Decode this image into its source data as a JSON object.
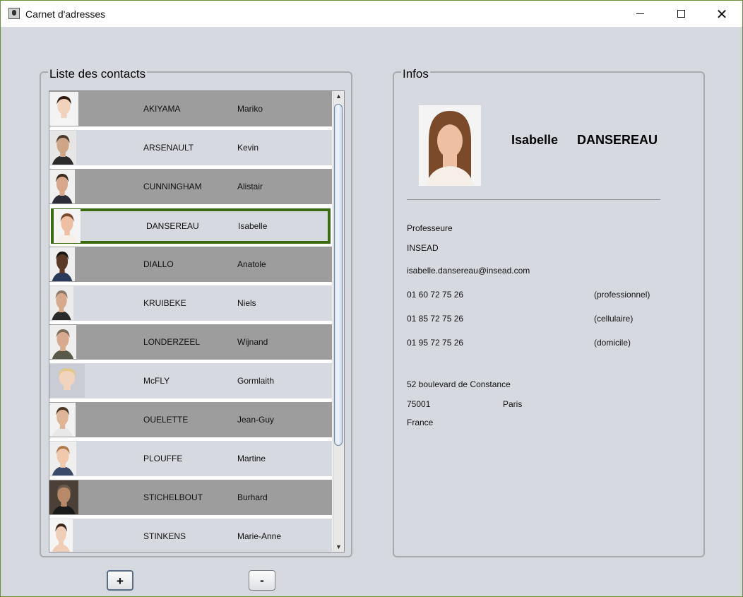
{
  "window": {
    "title": "Carnet d'adresses"
  },
  "list_panel": {
    "title": "Liste des contacts"
  },
  "contacts": [
    {
      "last_name": "AKIYAMA",
      "first_name": "Mariko",
      "highlighted": true,
      "selected": false,
      "hair": "#2a1a10",
      "skin": "#f1d2bd",
      "bg": "#f3f3f3",
      "shirt": "#f5f5f5",
      "w": 41
    },
    {
      "last_name": "ARSENAULT",
      "first_name": "Kevin",
      "highlighted": false,
      "selected": false,
      "hair": "#4a3a2e",
      "skin": "#cfa587",
      "bg": "#e6e6e6",
      "shirt": "#2a2a2a",
      "w": 38
    },
    {
      "last_name": "CUNNINGHAM",
      "first_name": "Alistair",
      "highlighted": true,
      "selected": false,
      "hair": "#3a2a1e",
      "skin": "#d9a88a",
      "bg": "#f0f0f0",
      "shirt": "#2c2c36",
      "w": 36
    },
    {
      "last_name": "DANSEREAU",
      "first_name": "Isabelle",
      "highlighted": false,
      "selected": true,
      "hair": "#7a4a2a",
      "skin": "#eebfa3",
      "bg": "#f4f4f4",
      "shirt": "#f5efe8",
      "w": 38
    },
    {
      "last_name": "DIALLO",
      "first_name": "Anatole",
      "highlighted": true,
      "selected": false,
      "hair": "#1a1410",
      "skin": "#5a3a26",
      "bg": "#efefef",
      "shirt": "#2b3a5a",
      "w": 36
    },
    {
      "last_name": "KRUIBEKE",
      "first_name": "Niels",
      "highlighted": false,
      "selected": false,
      "hair": "#8a7a6a",
      "skin": "#d8aa8c",
      "bg": "#ececec",
      "shirt": "#2a2a2a",
      "w": 34
    },
    {
      "last_name": "LONDERZEEL",
      "first_name": "Wijnand",
      "highlighted": true,
      "selected": false,
      "hair": "#7a6a5a",
      "skin": "#d9ab8e",
      "bg": "#eeeeee",
      "shirt": "#5a5a4a",
      "w": 38
    },
    {
      "last_name": "McFLY",
      "first_name": "Gormlaith",
      "highlighted": false,
      "selected": false,
      "hair": "#e2c88a",
      "skin": "#f2d3bd",
      "bg": "#c9ccd4",
      "shirt": "#c9ccd4",
      "w": 50
    },
    {
      "last_name": "OUELETTE",
      "first_name": "Jean-Guy",
      "highlighted": true,
      "selected": false,
      "hair": "#4a3624",
      "skin": "#e0b496",
      "bg": "#f2f2f2",
      "shirt": "#e8e8e8",
      "w": 37
    },
    {
      "last_name": "PLOUFFE",
      "first_name": "Martine",
      "highlighted": false,
      "selected": false,
      "hair": "#b07a4a",
      "skin": "#f0c9ad",
      "bg": "#eeeeee",
      "shirt": "#3a4a6a",
      "w": 38
    },
    {
      "last_name": "STICHELBOUT",
      "first_name": "Burhard",
      "highlighted": true,
      "selected": false,
      "hair": "#6a5a4a",
      "skin": "#b88a6a",
      "bg": "#4a4038",
      "shirt": "#1a1a1a",
      "w": 41
    },
    {
      "last_name": "STINKENS",
      "first_name": "Marie-Anne",
      "highlighted": false,
      "selected": false,
      "hair": "#3a2618",
      "skin": "#f0cdb6",
      "bg": "#f5f5f5",
      "shirt": "#f0cdb6",
      "w": 33
    }
  ],
  "info_panel": {
    "title": "Infos",
    "first_name": "Isabelle",
    "last_name": "DANSEREAU",
    "job": "Professeure",
    "company": "INSEAD",
    "email": "isabelle.dansereau@insead.com",
    "phones": [
      {
        "number": "01 60 72 75 26",
        "type": "(professionnel)"
      },
      {
        "number": "01 85 72 75 26",
        "type": "(cellulaire)"
      },
      {
        "number": "01 95 72 75 26",
        "type": "(domicile)"
      }
    ],
    "street": "52 boulevard de Constance",
    "postal_code": "75001",
    "city": "Paris",
    "country": "France"
  },
  "buttons": {
    "add_label": "+",
    "remove_label": "-"
  },
  "icons": {
    "minimize": "minimize-icon",
    "maximize": "maximize-icon",
    "close": "close-icon",
    "app": "app-icon"
  },
  "colors": {
    "selection_border": "#3a6b12",
    "highlight_row": "#9d9d9d",
    "background": "#d6d9e0"
  }
}
